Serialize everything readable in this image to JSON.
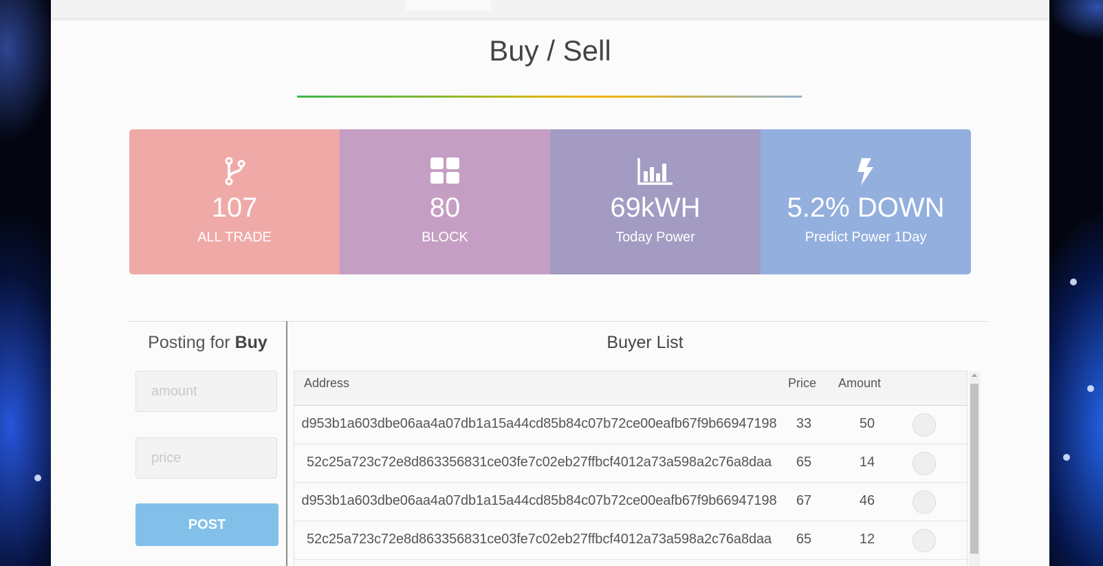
{
  "page_title": "Buy / Sell",
  "stats": [
    {
      "icon": "branch-icon",
      "value": "107",
      "label": "ALL TRADE",
      "color": "#efaaa8"
    },
    {
      "icon": "grid-icon",
      "value": "80",
      "label": "BLOCK",
      "color": "#c59ec3"
    },
    {
      "icon": "bar-chart-icon",
      "value": "69kWH",
      "label": "Today Power",
      "color": "#a39bc2"
    },
    {
      "icon": "lightning-icon",
      "value": "5.2% DOWN",
      "label": "Predict Power 1Day",
      "color": "#93afdd"
    }
  ],
  "post_form": {
    "title_prefix": "Posting for",
    "title_action": "Buy",
    "amount_placeholder": "amount",
    "price_placeholder": "price",
    "post_label": "POST",
    "post_color": "#82c0ea"
  },
  "buyer_list": {
    "title": "Buyer List",
    "columns": [
      "Address",
      "Price",
      "Amount"
    ],
    "rows": [
      {
        "address": "d953b1a603dbe06aa4a07db1a15a44cd85b84c07b72ce00eafb67f9b66947198",
        "price": "33",
        "amount": "50"
      },
      {
        "address": "52c25a723c72e8d863356831ce03fe7c02eb27ffbcf4012a73a598a2c76a8daa",
        "price": "65",
        "amount": "14"
      },
      {
        "address": "d953b1a603dbe06aa4a07db1a15a44cd85b84c07b72ce00eafb67f9b66947198",
        "price": "67",
        "amount": "46"
      },
      {
        "address": "52c25a723c72e8d863356831ce03fe7c02eb27ffbcf4012a73a598a2c76a8daa",
        "price": "65",
        "amount": "12"
      }
    ]
  }
}
